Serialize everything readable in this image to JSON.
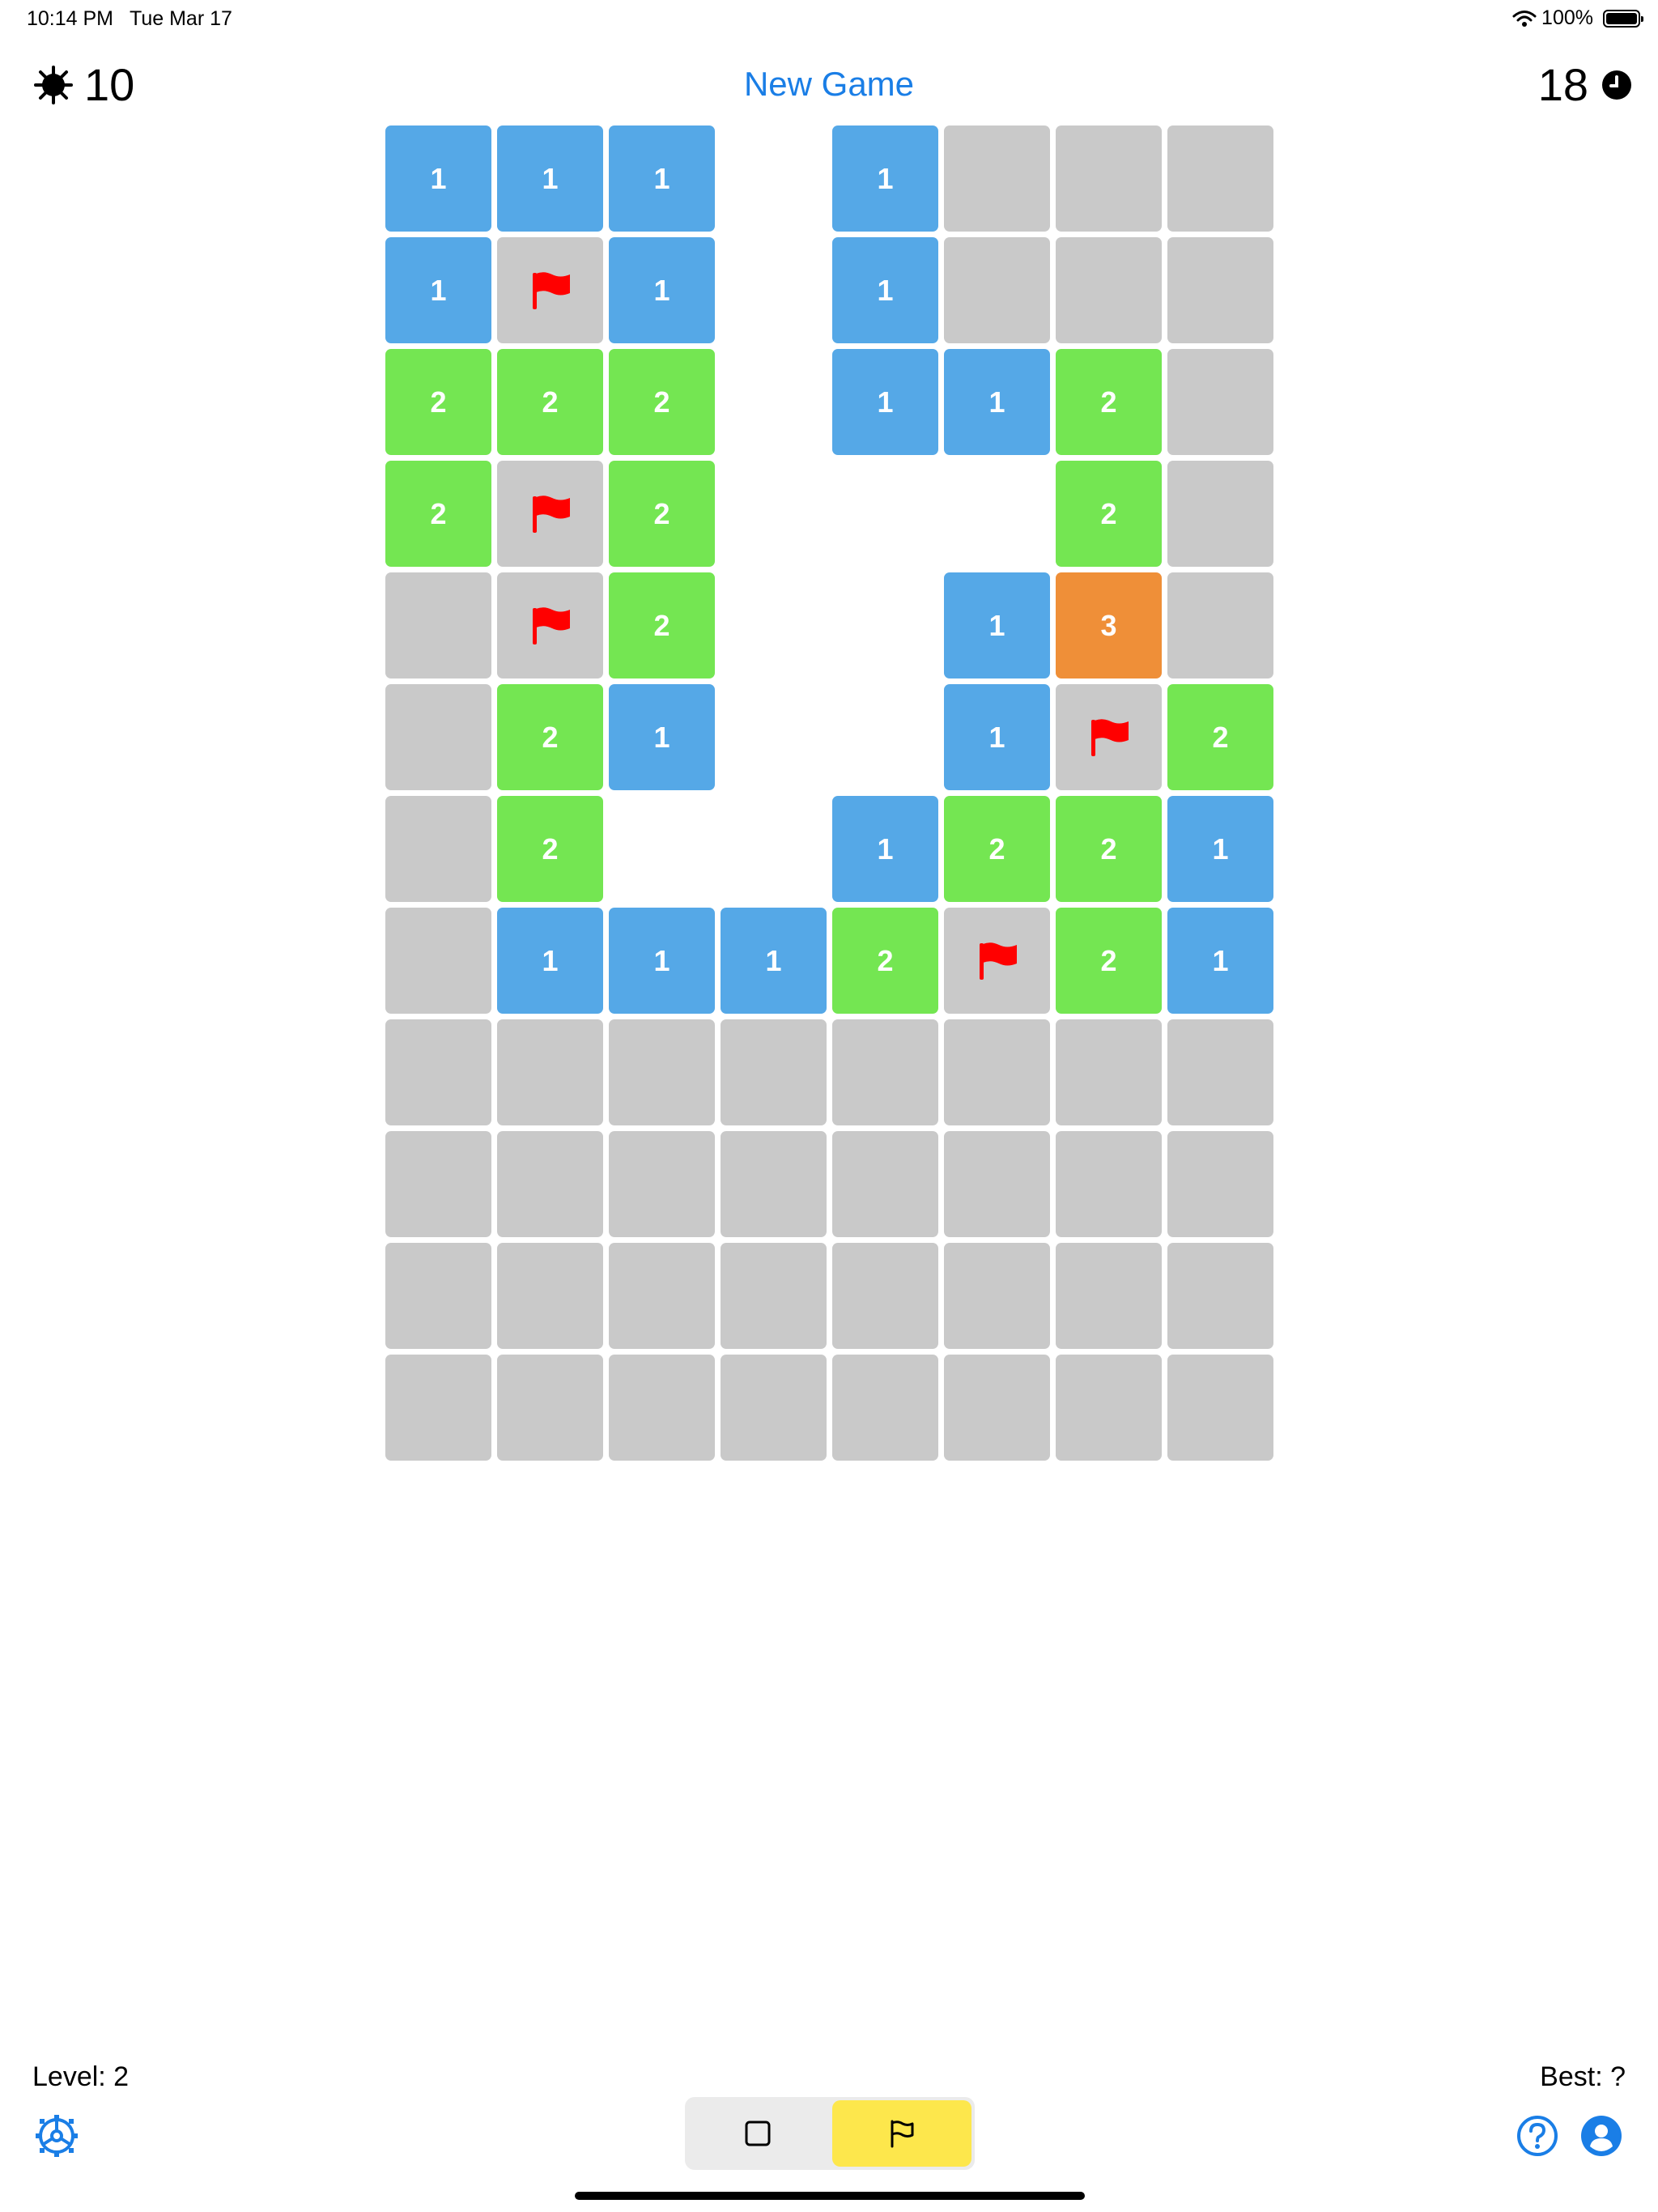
{
  "status_bar": {
    "time": "10:14 PM",
    "date": "Tue Mar 17",
    "battery": "100%"
  },
  "header": {
    "mines_remaining": "10",
    "new_game_label": "New Game",
    "elapsed_time": "18"
  },
  "board": {
    "columns": 8,
    "rows": [
      [
        "1",
        "1",
        "1",
        "",
        "1",
        "#",
        "#",
        "#"
      ],
      [
        "1",
        "F",
        "1",
        "",
        "1",
        "#",
        "#",
        "#"
      ],
      [
        "2",
        "2",
        "2",
        "",
        "1",
        "1",
        "2",
        "#"
      ],
      [
        "2",
        "F",
        "2",
        "",
        "",
        "",
        "2",
        "#"
      ],
      [
        "#",
        "F",
        "2",
        "",
        "",
        "1",
        "3",
        "#"
      ],
      [
        "#",
        "2",
        "1",
        "",
        "",
        "1",
        "F",
        "2"
      ],
      [
        "#",
        "2",
        "",
        "",
        "1",
        "2",
        "2",
        "1"
      ],
      [
        "#",
        "1",
        "1",
        "1",
        "2",
        "F",
        "2",
        "1"
      ],
      [
        "#",
        "#",
        "#",
        "#",
        "#",
        "#",
        "#",
        "#"
      ],
      [
        "#",
        "#",
        "#",
        "#",
        "#",
        "#",
        "#",
        "#"
      ],
      [
        "#",
        "#",
        "#",
        "#",
        "#",
        "#",
        "#",
        "#"
      ],
      [
        "#",
        "#",
        "#",
        "#",
        "#",
        "#",
        "#",
        "#"
      ]
    ],
    "legend": {
      "#": "hidden",
      "F": "flag",
      "": "revealed-empty"
    },
    "colors": {
      "hidden": "#c9c9c9",
      "1": "#55a8e7",
      "2": "#74e652",
      "3": "#ef8f38",
      "flag": "#ff0000"
    }
  },
  "footer": {
    "level_text": "Level: 2",
    "best_text": "Best: ?",
    "mode_toggle": {
      "options": [
        "reveal",
        "flag"
      ],
      "selected": "flag"
    }
  },
  "icons": [
    "mine-icon",
    "clock-icon",
    "flag-icon",
    "gear-icon",
    "help-icon",
    "user-icon",
    "square-icon",
    "wifi-icon",
    "battery-icon"
  ],
  "accent_color": "#1a7ee6"
}
